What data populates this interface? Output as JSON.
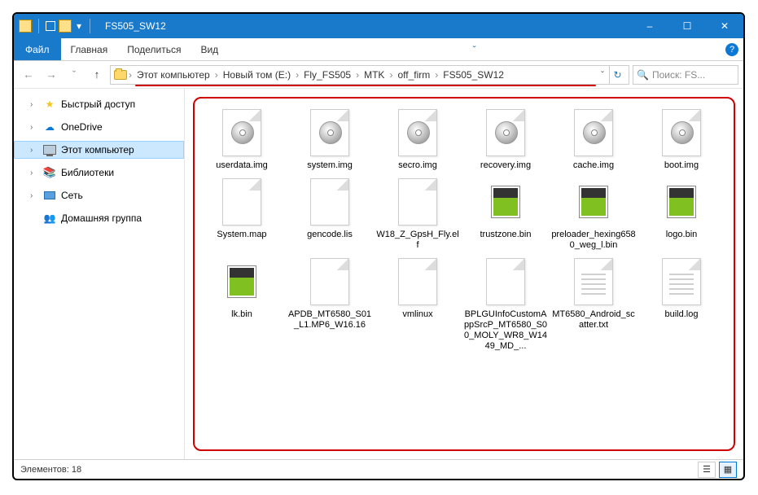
{
  "window": {
    "title": "FS505_SW12",
    "minimize": "–",
    "maximize": "☐",
    "close": "✕"
  },
  "ribbon": {
    "file": "Файл",
    "tabs": [
      "Главная",
      "Поделиться",
      "Вид"
    ],
    "help": "?"
  },
  "address": {
    "crumbs": [
      "Этот компьютер",
      "Новый том (E:)",
      "Fly_FS505",
      "MTK",
      "off_firm",
      "FS505_SW12"
    ]
  },
  "search": {
    "placeholder": "Поиск: FS..."
  },
  "sidebar": [
    {
      "label": "Быстрый доступ",
      "icon": "star",
      "expand": true
    },
    {
      "label": "OneDrive",
      "icon": "cloud",
      "expand": true
    },
    {
      "label": "Этот компьютер",
      "icon": "pc",
      "expand": true,
      "selected": true
    },
    {
      "label": "Библиотеки",
      "icon": "lib",
      "expand": true
    },
    {
      "label": "Сеть",
      "icon": "net",
      "expand": true
    },
    {
      "label": "Домашняя группа",
      "icon": "home",
      "expand": false
    }
  ],
  "files": [
    {
      "name": "userdata.img",
      "type": "disc"
    },
    {
      "name": "system.img",
      "type": "disc"
    },
    {
      "name": "secro.img",
      "type": "disc"
    },
    {
      "name": "recovery.img",
      "type": "disc"
    },
    {
      "name": "cache.img",
      "type": "disc"
    },
    {
      "name": "boot.img",
      "type": "disc"
    },
    {
      "name": "System.map",
      "type": "file"
    },
    {
      "name": "gencode.lis",
      "type": "file"
    },
    {
      "name": "W18_Z_GpsH_Fly.elf",
      "type": "file"
    },
    {
      "name": "trustzone.bin",
      "type": "android"
    },
    {
      "name": "preloader_hexing6580_weg_l.bin",
      "type": "android"
    },
    {
      "name": "logo.bin",
      "type": "android"
    },
    {
      "name": "lk.bin",
      "type": "android"
    },
    {
      "name": "APDB_MT6580_S01_L1.MP6_W16.16",
      "type": "file"
    },
    {
      "name": "vmlinux",
      "type": "file"
    },
    {
      "name": "BPLGUInfoCustomAppSrcP_MT6580_S00_MOLY_WR8_W1449_MD_...",
      "type": "file"
    },
    {
      "name": "MT6580_Android_scatter.txt",
      "type": "text"
    },
    {
      "name": "build.log",
      "type": "text"
    }
  ],
  "status": {
    "label": "Элементов:",
    "count": "18"
  }
}
